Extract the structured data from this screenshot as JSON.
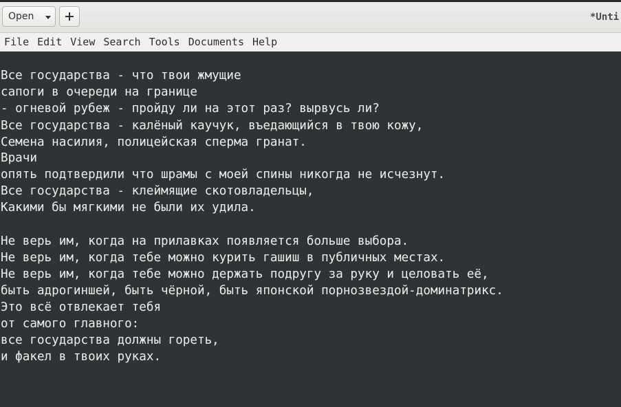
{
  "header": {
    "open_label": "Open",
    "new_tab_icon": "plus-icon",
    "dropdown_icon": "chevron-down-icon",
    "title": "*Unti"
  },
  "menu": {
    "items": [
      "File",
      "Edit",
      "View",
      "Search",
      "Tools",
      "Documents",
      "Help"
    ]
  },
  "editor": {
    "lines": [
      "",
      "Все государства - что твои жмущие",
      "сапоги в очереди на границе",
      "- огневой рубеж - пройду ли на этот раз? вырвусь ли?",
      "Все государства - калёный каучук, въедающийся в твою кожу,",
      "Семена насилия, полицейская сперма гранат.",
      "Врачи",
      "опять подтвердили что шрамы с моей спины никогда не исчезнут.",
      "Все государства - клеймящие скотовладельцы,",
      "Какими бы мягкими не были их удила.",
      "",
      "Не верь им, когда на прилавках появляется больше выбора.",
      "Не верь им, когда тебе можно курить гашиш в публичных местах.",
      "Не верь им, когда тебе можно держать подругу за руку и целовать её,",
      "быть адрогиншей, быть чёрной, быть японской порнозвездой-доминатрикс.",
      "Это всё отвлекает тебя",
      "от самого главного:",
      "все государства должны гореть,",
      "и факел в твоих руках."
    ]
  },
  "colors": {
    "editor_background": "#2e3436",
    "editor_text": "#eeeeec",
    "header_background": "#ededeb",
    "menubar_background": "#f2f1f0"
  }
}
